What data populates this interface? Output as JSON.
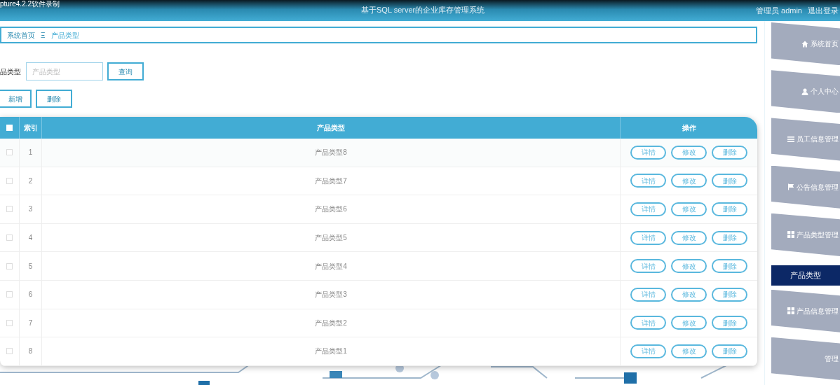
{
  "recorder_caption": "pture4.2.2软件录制",
  "header": {
    "title": "基于SQL server的企业库存管理系统",
    "user": "管理员 admin",
    "logout": "退出登录"
  },
  "breadcrumb": [
    {
      "label": "系统首页"
    },
    {
      "label": "产品类型"
    }
  ],
  "breadcrumb_separator": "Ξ",
  "search": {
    "label": "品类型",
    "placeholder": "产品类型",
    "button": "查询"
  },
  "actions": [
    "新增",
    "删除"
  ],
  "table": {
    "columns": [
      "索引",
      "产品类型",
      "操作"
    ],
    "all_checked": false,
    "rows": [
      {
        "index": "1",
        "type": "产品类型8",
        "checked": false,
        "buttons": [
          "详情",
          "修改",
          "删除"
        ]
      },
      {
        "index": "2",
        "type": "产品类型7",
        "checked": false,
        "buttons": [
          "详情",
          "修改",
          "删除"
        ]
      },
      {
        "index": "3",
        "type": "产品类型6",
        "checked": false,
        "buttons": [
          "详情",
          "修改",
          "删除"
        ]
      },
      {
        "index": "4",
        "type": "产品类型5",
        "checked": false,
        "buttons": [
          "详情",
          "修改",
          "删除"
        ]
      },
      {
        "index": "5",
        "type": "产品类型4",
        "checked": false,
        "buttons": [
          "详情",
          "修改",
          "删除"
        ]
      },
      {
        "index": "6",
        "type": "产品类型3",
        "checked": false,
        "buttons": [
          "详情",
          "修改",
          "删除"
        ]
      },
      {
        "index": "7",
        "type": "产品类型2",
        "checked": false,
        "buttons": [
          "详情",
          "修改",
          "删除"
        ]
      },
      {
        "index": "8",
        "type": "产品类型1",
        "checked": false,
        "buttons": [
          "详情",
          "修改",
          "删除"
        ]
      }
    ]
  },
  "sidebar": {
    "items": [
      {
        "label": "系统首页",
        "selected": false,
        "kind": "menu"
      },
      {
        "label": "个人中心",
        "selected": false,
        "kind": "menu"
      },
      {
        "label": "员工信息管理",
        "selected": false,
        "kind": "menu"
      },
      {
        "label": "公告信息管理",
        "selected": false,
        "kind": "menu"
      },
      {
        "label": "产品类型管理",
        "selected": false,
        "kind": "menu"
      },
      {
        "label": "产品类型",
        "selected": true,
        "kind": "submenu"
      },
      {
        "label": "产品信息管理",
        "selected": false,
        "kind": "menu"
      },
      {
        "label": "管理",
        "selected": false,
        "kind": "menu"
      }
    ]
  }
}
